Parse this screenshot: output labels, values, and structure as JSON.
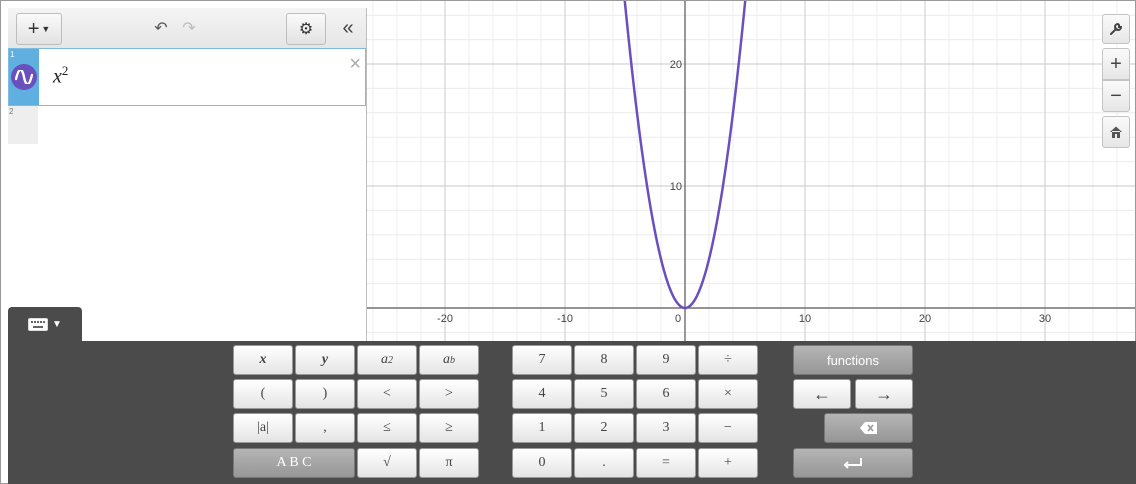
{
  "toolbar": {
    "add_label": "+",
    "undo_glyph": "↶",
    "redo_glyph": "↷",
    "settings_glyph": "⚙",
    "collapse_glyph": "«"
  },
  "expressions": [
    {
      "index": "1",
      "latex_base": "x",
      "latex_sup": "2",
      "color": "#6a4fbf",
      "close_glyph": "×"
    },
    {
      "index": "2"
    }
  ],
  "graph": {
    "x_ticks": [
      "-20",
      "-10",
      "0",
      "10",
      "20",
      "30"
    ],
    "y_ticks": [
      "20",
      "10"
    ],
    "curve_color": "#6a4fbf"
  },
  "right_controls": {
    "zoom_in": "+",
    "zoom_out": "−"
  },
  "keypad": {
    "rows": [
      [
        "x",
        "y",
        "a2",
        "ab"
      ],
      [
        "(",
        ")",
        "<",
        ">"
      ],
      [
        "|a|",
        ",",
        "≤",
        "≥"
      ],
      [
        "A B C",
        "√",
        "π"
      ]
    ],
    "numpad": [
      [
        "7",
        "8",
        "9",
        "÷"
      ],
      [
        "4",
        "5",
        "6",
        "×"
      ],
      [
        "1",
        "2",
        "3",
        "−"
      ],
      [
        "0",
        ".",
        "=",
        "+"
      ]
    ],
    "functions_label": "functions",
    "left_arrow": "←",
    "right_arrow": "→"
  }
}
